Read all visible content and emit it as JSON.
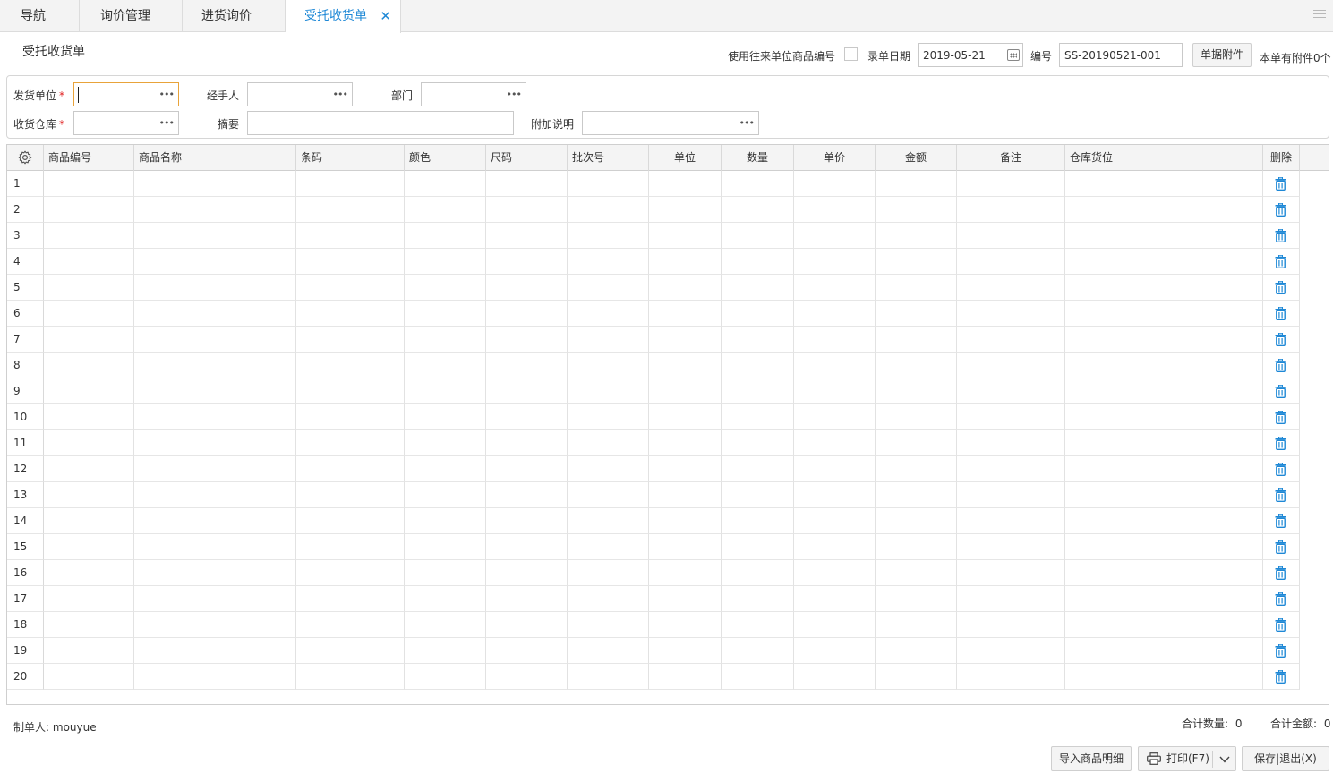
{
  "tabs": [
    {
      "label": "导航"
    },
    {
      "label": "询价管理"
    },
    {
      "label": "进货询价"
    },
    {
      "label": "受托收货单"
    }
  ],
  "page_title": "受托收货单",
  "header": {
    "use_partner_code_label": "使用往来单位商品编号",
    "entry_date_label": "录单日期",
    "entry_date_value": "2019-05-21",
    "number_label": "编号",
    "number_value": "SS-20190521-001",
    "attachment_button": "单据附件",
    "attachment_count_text": "本单有附件0个"
  },
  "form": {
    "shipper_label": "发货单位",
    "handler_label": "经手人",
    "department_label": "部门",
    "warehouse_label": "收货仓库",
    "summary_label": "摘要",
    "note_label": "附加说明",
    "required_mark": "*",
    "ellipsis": "•••"
  },
  "grid": {
    "columns": [
      "商品编号",
      "商品名称",
      "条码",
      "颜色",
      "尺码",
      "批次号",
      "单位",
      "数量",
      "单价",
      "金额",
      "备注",
      "仓库货位",
      "删除"
    ],
    "rows": [
      "1",
      "2",
      "3",
      "4",
      "5",
      "6",
      "7",
      "8",
      "9",
      "10",
      "11",
      "12",
      "13",
      "14",
      "15",
      "16",
      "17",
      "18",
      "19",
      "20"
    ]
  },
  "footer": {
    "maker_label": "制单人:",
    "maker_value": "mouyue",
    "total_qty_label": "合计数量:",
    "total_qty_value": "0",
    "total_amount_label": "合计金额:",
    "total_amount_value": "0",
    "import_button": "导入商品明细",
    "print_button": "打印(F7)",
    "save_exit_button": "保存|退出(X)"
  },
  "colors": {
    "accent": "#1e88d6",
    "required": "#e02020",
    "trash": "#1e88d6"
  }
}
